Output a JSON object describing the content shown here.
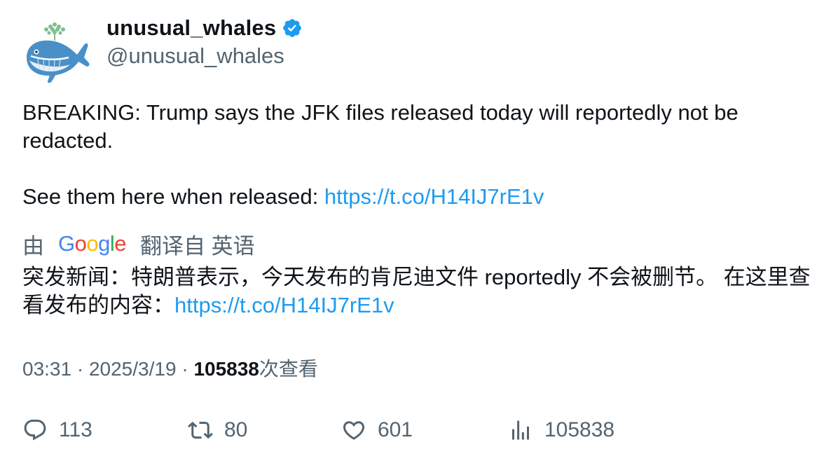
{
  "author": {
    "display_name": "unusual_whales",
    "handle": "@unusual_whales",
    "avatar_icon": "whale-avatar-icon",
    "verified_icon": "verified-badge-icon",
    "verified_color": "#1d9bf0"
  },
  "tweet": {
    "line1": "BREAKING: Trump says the JFK files released today will reportedly not be redacted.",
    "line2_prefix": "See them here when released: ",
    "link": "https://t.co/H14IJ7rE1v"
  },
  "translation": {
    "by_label": "由",
    "google_label": "Google",
    "from_label": "翻译自 英语",
    "text": "突发新闻：特朗普表示，今天发布的肯尼迪文件 reportedly 不会被删节。 在这里查看发布的内容：",
    "link": "https://t.co/H14IJ7rE1v"
  },
  "meta": {
    "time": "03:31",
    "separator": " · ",
    "date": "2025/3/19",
    "views_count": "105838",
    "views_label": "次查看"
  },
  "actions": {
    "replies": "113",
    "retweets": "80",
    "likes": "601",
    "views": "105838",
    "icon_color": "#536471"
  },
  "colors": {
    "link": "#1d9bf0",
    "secondary_text": "#536471",
    "primary_text": "#0f1419"
  }
}
